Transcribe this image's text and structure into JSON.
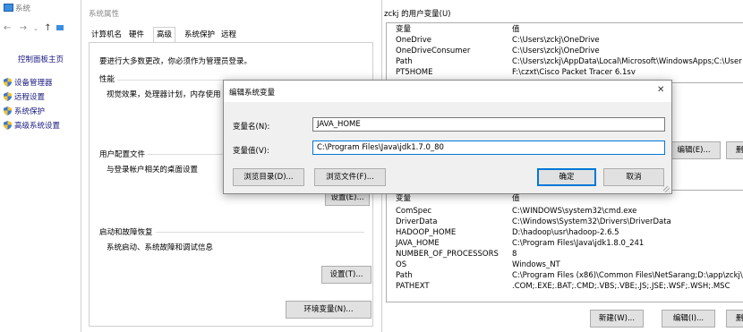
{
  "control_panel": {
    "title": "系统",
    "home_link": "控制面板主页",
    "links": [
      "设备管理器",
      "远程设置",
      "系统保护",
      "高级系统设置"
    ]
  },
  "sys_props": {
    "title": "系统属性",
    "tabs": [
      "计算机名",
      "硬件",
      "高级",
      "系统保护",
      "远程"
    ],
    "admin_note": "要进行大多数更改，你必须作为管理员登录。",
    "perf_title": "性能",
    "perf_desc": "视觉效果，处理器计划，内存使用",
    "profiles_title": "用户配置文件",
    "profiles_desc": "与登录帐户相关的桌面设置",
    "profiles_btn": "设置(E)...",
    "startup_title": "启动和故障恢复",
    "startup_desc": "系统启动、系统故障和调试信息",
    "startup_btn": "设置(T)...",
    "env_btn": "环境变量(N)..."
  },
  "env_vars": {
    "user_group_title": "zckj 的用户变量(U)",
    "col_name": "变量",
    "col_value": "值",
    "user_vars": [
      {
        "name": "OneDrive",
        "value": "C:\\Users\\zckj\\OneDrive"
      },
      {
        "name": "OneDriveConsumer",
        "value": "C:\\Users\\zckj\\OneDrive"
      },
      {
        "name": "Path",
        "value": "C:\\Users\\zckj\\AppData\\Local\\Microsoft\\WindowsApps;C:\\User"
      },
      {
        "name": "PT5HOME",
        "value": "F:\\czxt\\Cisco Packet Tracer 6.1sv"
      }
    ],
    "user_edit_btn": "编辑(E)...",
    "user_cut_btn": "删",
    "sys_vars": [
      {
        "name": "ComSpec",
        "value": "C:\\WINDOWS\\system32\\cmd.exe"
      },
      {
        "name": "DriverData",
        "value": "C:\\Windows\\System32\\Drivers\\DriverData"
      },
      {
        "name": "HADOOP_HOME",
        "value": "D:\\hadoop\\usr\\hadoop-2.6.5"
      },
      {
        "name": "JAVA_HOME",
        "value": "C:\\Program Files\\Java\\jdk1.8.0_241"
      },
      {
        "name": "NUMBER_OF_PROCESSORS",
        "value": "8"
      },
      {
        "name": "OS",
        "value": "Windows_NT"
      },
      {
        "name": "Path",
        "value": "C:\\Program Files (x86)\\Common Files\\NetSarang;D:\\app\\zckj\\p"
      },
      {
        "name": "PATHEXT",
        "value": ".COM;.EXE;.BAT;.CMD;.VBS;.VBE;.JS;.JSE;.WSF;.WSH;.MSC"
      }
    ],
    "new_btn": "新建(W)...",
    "edit_btn": "编辑(I)...",
    "del_btn": "删"
  },
  "edit_dialog": {
    "title": "编辑系统变量",
    "close": "✕",
    "name_label": "变量名(N):",
    "name_value": "JAVA_HOME",
    "value_label": "变量值(V):",
    "value_value": "C:\\Program Files\\Java\\jdk1.7.0_80",
    "browse_dir": "浏览目录(D)...",
    "browse_file": "浏览文件(F)...",
    "ok": "确定",
    "cancel": "取消"
  }
}
